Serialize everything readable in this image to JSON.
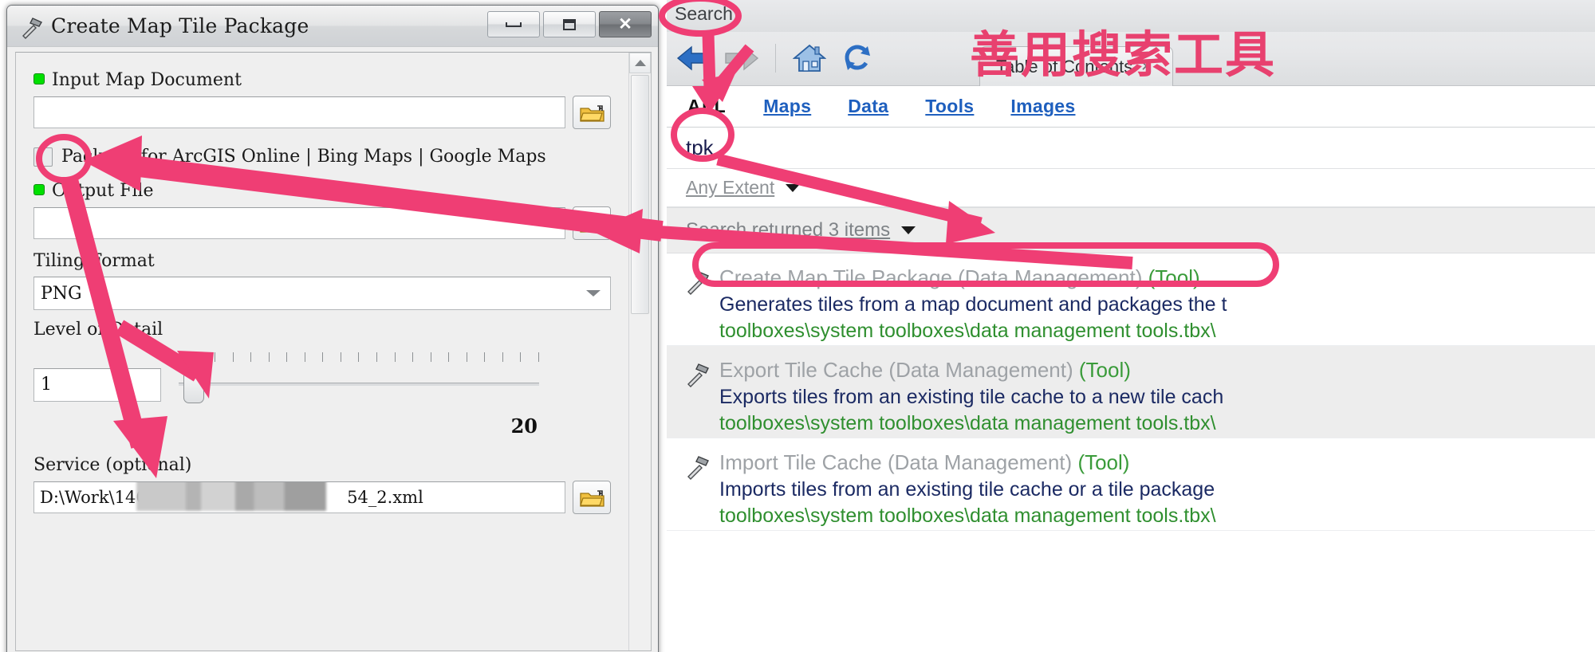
{
  "dialog": {
    "title": "Create Map Tile Package",
    "title_icon": "hammer-tool-icon",
    "window_buttons": {
      "minimize": "–",
      "maximize": "□",
      "close": "✕"
    },
    "fields": {
      "input_map_document": {
        "label": "Input Map Document",
        "value": "",
        "required": true,
        "browse": "folder-browse-icon"
      },
      "package_checkbox": {
        "label": "Package for ArcGIS Online | Bing Maps | Google Maps",
        "checked": false
      },
      "output_file": {
        "label": "Output File",
        "value": "",
        "required": true,
        "browse": "folder-browse-icon"
      },
      "tiling_format": {
        "label": "Tiling Format",
        "value": "PNG"
      },
      "level_of_detail": {
        "label": "Level of Detail",
        "value": "1",
        "max_label": "20",
        "tick_count": 21
      },
      "service": {
        "label": "Service (optional)",
        "value_prefix": "D:\\Work\\1406",
        "value_suffix": "54_2.xml",
        "redacted": true
      }
    }
  },
  "search_panel": {
    "panel_label": "Search",
    "nav": {
      "back": "back-arrow-icon",
      "forward": "forward-arrow-icon",
      "home": "home-icon",
      "refresh": "refresh-icon"
    },
    "panel_tab": {
      "label": "Table of Contents",
      "close": "✕"
    },
    "tabs": [
      {
        "label": "ALL",
        "active": true
      },
      {
        "label": "Maps",
        "active": false
      },
      {
        "label": "Data",
        "active": false
      },
      {
        "label": "Tools",
        "active": false
      },
      {
        "label": "Images",
        "active": false
      }
    ],
    "query": "tpk",
    "extent_filter": "Any Extent",
    "result_count_label": "Search returned 3 items",
    "results": [
      {
        "icon": "hammer-tool-icon",
        "title": "Create Map Tile Package (Data Management)",
        "type": "(Tool)",
        "description": "Generates tiles from a map document and packages the t",
        "path": "toolboxes\\system toolboxes\\data management tools.tbx\\"
      },
      {
        "icon": "hammer-tool-icon",
        "title": "Export Tile Cache (Data Management)",
        "type": "(Tool)",
        "description": "Exports tiles from an existing tile cache to a new tile cach",
        "path": "toolboxes\\system toolboxes\\data management tools.tbx\\"
      },
      {
        "icon": "hammer-tool-icon",
        "title": "Import Tile Cache (Data Management)",
        "type": "(Tool)",
        "description": "Imports tiles from an existing tile cache or a tile package",
        "path": "toolboxes\\system toolboxes\\data management tools.tbx\\"
      }
    ]
  },
  "annotations": {
    "chinese_note": "善用搜索工具",
    "accent_color": "#ef3e74"
  }
}
